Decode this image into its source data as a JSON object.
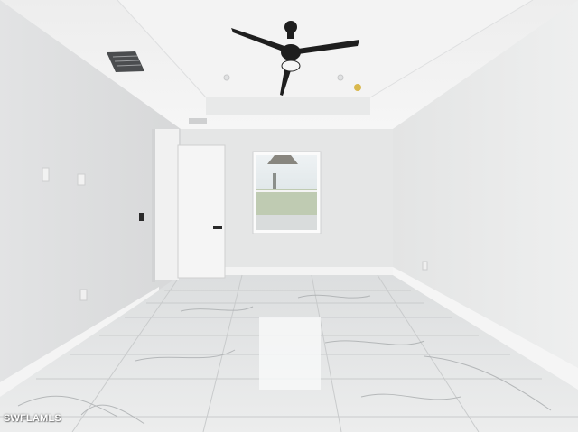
{
  "photo": {
    "subject": "empty-room-interior",
    "watermark": "SWFLAMLS"
  },
  "colors": {
    "wall": "#e6e7e7",
    "ceiling": "#efefef",
    "floor": "#e4e5e6",
    "fan": "#1e1e1e",
    "door": "#f4f4f4"
  }
}
